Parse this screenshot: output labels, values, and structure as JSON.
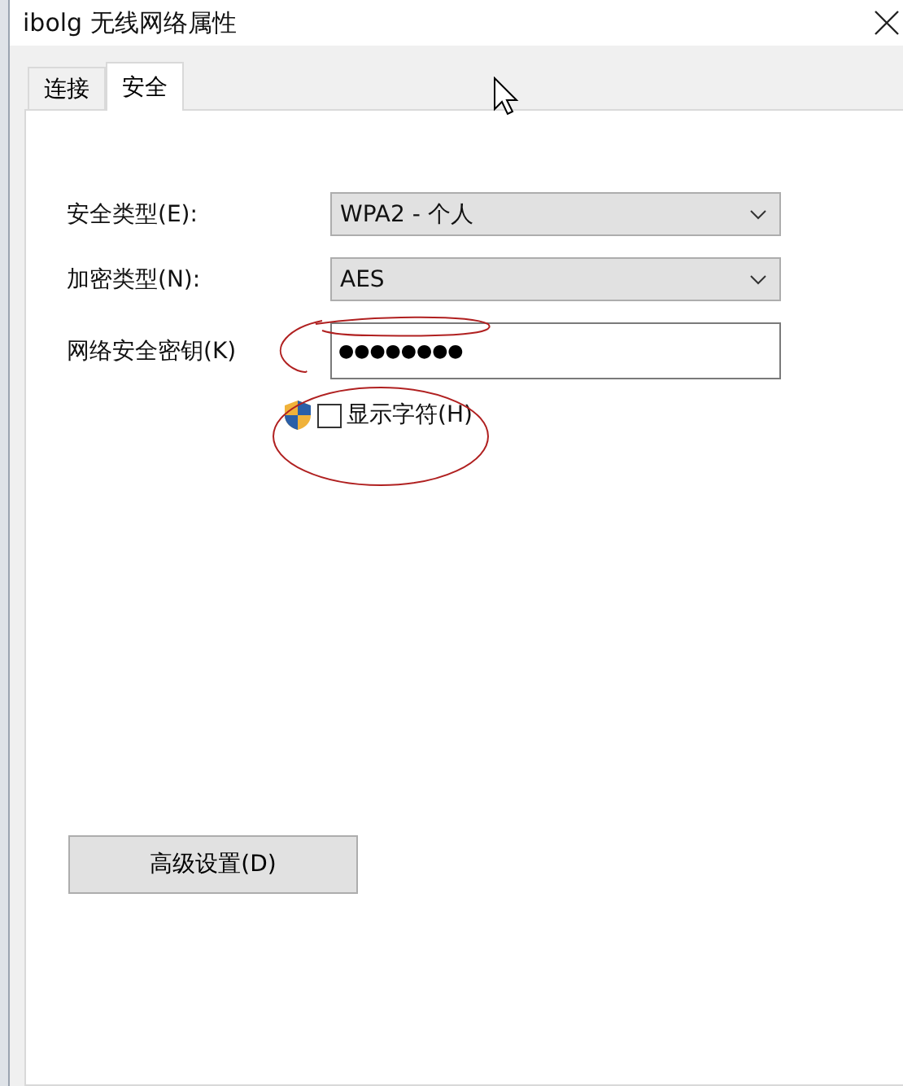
{
  "window": {
    "title": "ibolg 无线网络属性"
  },
  "tabs": [
    {
      "label": "连接",
      "selected": false
    },
    {
      "label": "安全",
      "selected": true
    }
  ],
  "fields": [
    {
      "kind": "dropdown",
      "label": "安全类型(E):",
      "value": "WPA2 - 个人"
    },
    {
      "kind": "dropdown",
      "label": "加密类型(N):",
      "value": "AES"
    },
    {
      "kind": "password",
      "label": "网络安全密钥(K)",
      "value": "●●●●●●●●"
    }
  ],
  "show_characters": {
    "label": "显示字符(H)",
    "checked": false
  },
  "buttons": [
    "高级设置(D)"
  ]
}
